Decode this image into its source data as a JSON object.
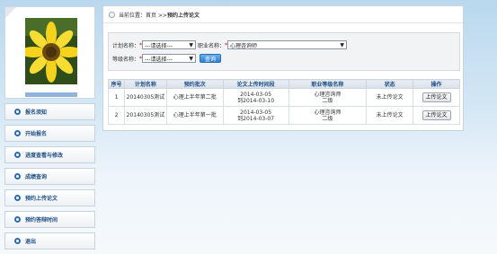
{
  "breadcrumb": {
    "prefix": "当前位置：首页 >> ",
    "current": "预约上传论文"
  },
  "filters": {
    "plan_label": "计划名称：",
    "plan_value": "---请选择---",
    "profession_label": "职业名称：",
    "profession_value": "心理咨询师",
    "level_label": "等级名称：",
    "level_value": "---请选择---",
    "query_button": "查询",
    "required_mark": "*"
  },
  "table": {
    "headers": [
      "序号",
      "计划名称",
      "预约批次",
      "论文上传时间段",
      "职业等级名称",
      "状态",
      "操作"
    ],
    "rows": [
      {
        "index": "1",
        "plan": "20140305测试",
        "batch": "心理上半年第二批",
        "period_start": "2014-03-05",
        "period_end": "到2014-03-10",
        "profession": "心理咨询师",
        "level": "二级",
        "status": "未上传论文",
        "action": "上传论文"
      },
      {
        "index": "2",
        "plan": "20140305测试",
        "batch": "心理上半年第一批",
        "period_start": "2014-03-05",
        "period_end": "到2014-03-07",
        "profession": "心理咨询师",
        "level": "二级",
        "status": "未上传论文",
        "action": "上传论文"
      }
    ]
  },
  "sidebar": {
    "items": [
      {
        "label": "报名须知"
      },
      {
        "label": "开始报名"
      },
      {
        "label": "进度查看与修改"
      },
      {
        "label": "成绩查询"
      },
      {
        "label": "预约上传论文"
      },
      {
        "label": "预约答辩时间"
      },
      {
        "label": "退出"
      }
    ]
  },
  "colors": {
    "accent": "#1d4e86",
    "button_blue": "#2f7fcf",
    "required": "#cc0000"
  }
}
